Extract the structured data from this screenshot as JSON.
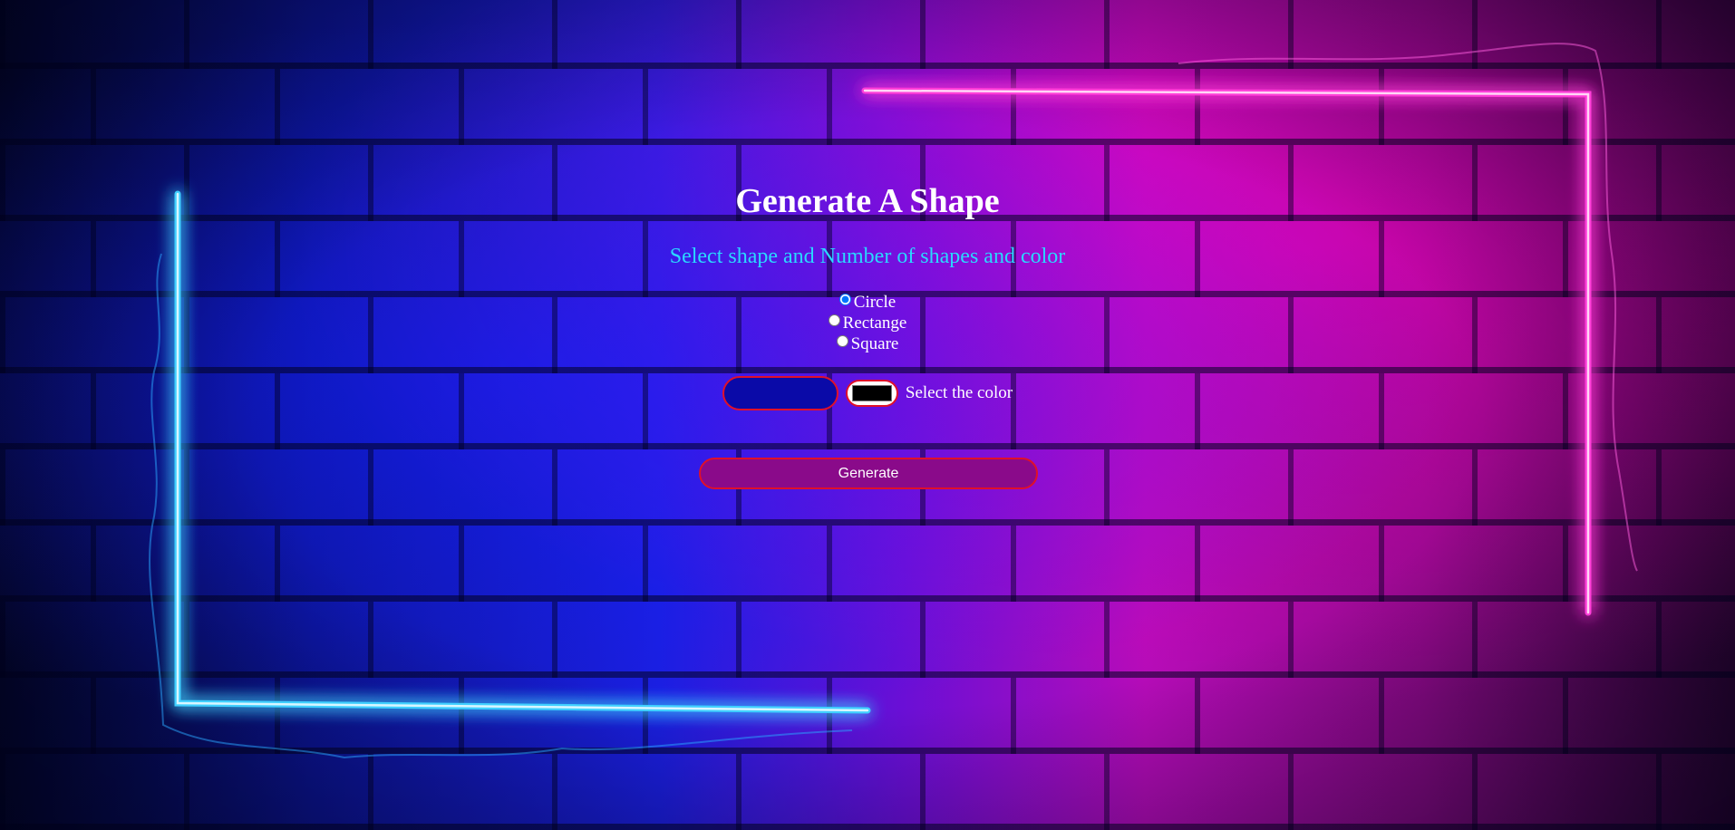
{
  "page": {
    "title": "Generate A Shape",
    "subtitle": "Select shape and Number of shapes and color"
  },
  "shape_options": [
    {
      "label": "Circle",
      "value": "circle",
      "checked": true
    },
    {
      "label": "Rectange",
      "value": "rectangle",
      "checked": false
    },
    {
      "label": "Square",
      "value": "square",
      "checked": false
    }
  ],
  "controls": {
    "count_value": "",
    "color_value": "#000000",
    "color_label": "Select the color",
    "generate_label": "Generate"
  },
  "colors": {
    "neon_blue": "#3fd0ff",
    "neon_pink": "#ff3cd8",
    "input_bg": "#0a0aa8",
    "button_bg": "#8a0a8a",
    "border_red": "#e0102a",
    "subtitle": "#2ad8ff"
  }
}
